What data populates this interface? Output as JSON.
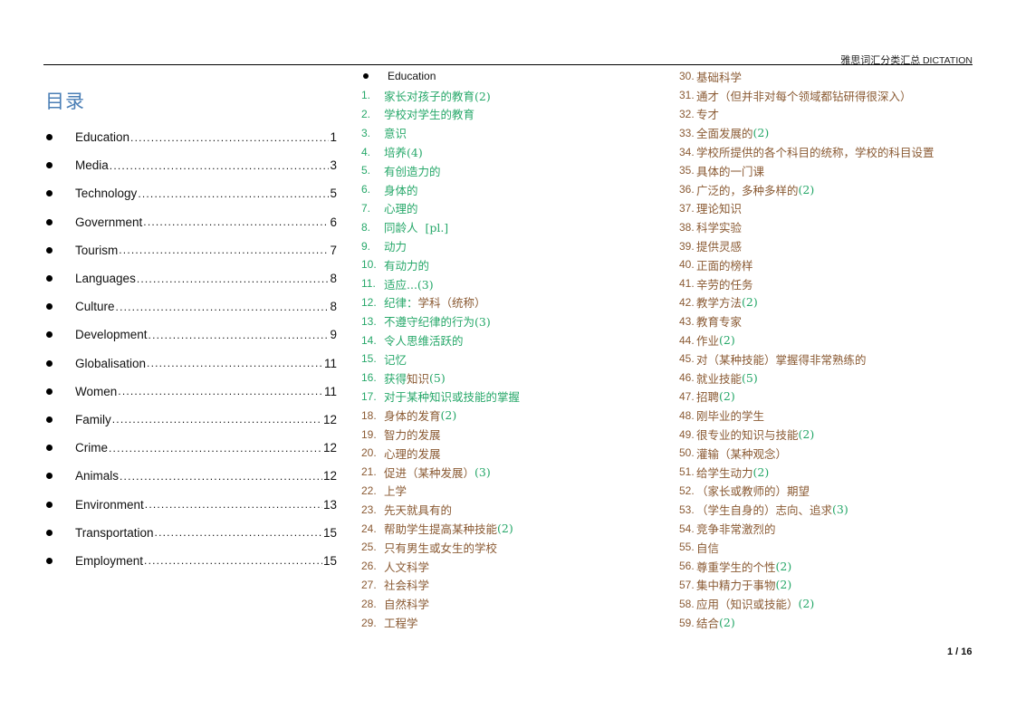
{
  "colors": {
    "green": "#27a86a",
    "brown": "#8a5a33",
    "toc_heading": "#4a7eb5"
  },
  "header": {
    "title_cn": "雅思词汇分类汇总",
    "title_en": "DICTATION"
  },
  "toc": {
    "heading": "目录",
    "items": [
      {
        "label": "Education",
        "page": "1"
      },
      {
        "label": "Media",
        "page": "3"
      },
      {
        "label": "Technology",
        "page": "5"
      },
      {
        "label": "Government",
        "page": "6"
      },
      {
        "label": "Tourism",
        "page": "7"
      },
      {
        "label": "Languages",
        "page": "8"
      },
      {
        "label": "Culture",
        "page": "8"
      },
      {
        "label": "Development",
        "page": "9"
      },
      {
        "label": "Globalisation",
        "page": "11"
      },
      {
        "label": "Women",
        "page": "11"
      },
      {
        "label": "Family",
        "page": "12"
      },
      {
        "label": "Crime",
        "page": "12"
      },
      {
        "label": "Animals",
        "page": "12"
      },
      {
        "label": "Environment",
        "page": "13"
      },
      {
        "label": "Transportation",
        "page": "15"
      },
      {
        "label": "Employment",
        "page": "15"
      }
    ]
  },
  "section": {
    "title": "Education"
  },
  "vocab": [
    {
      "num": "1.",
      "numColor": "green",
      "segs": [
        {
          "t": "家长对孩子的教育(2)",
          "c": "green"
        }
      ]
    },
    {
      "num": "2.",
      "numColor": "green",
      "segs": [
        {
          "t": "学校对学生的教育",
          "c": "green"
        }
      ]
    },
    {
      "num": "3.",
      "numColor": "green",
      "segs": [
        {
          "t": "意识",
          "c": "green"
        }
      ]
    },
    {
      "num": "4.",
      "numColor": "green",
      "segs": [
        {
          "t": "培养(4)",
          "c": "green"
        }
      ]
    },
    {
      "num": "5.",
      "numColor": "green",
      "segs": [
        {
          "t": "有创造力的",
          "c": "green"
        }
      ]
    },
    {
      "num": "6.",
      "numColor": "green",
      "segs": [
        {
          "t": "身体的",
          "c": "green"
        }
      ]
    },
    {
      "num": "7.",
      "numColor": "green",
      "segs": [
        {
          "t": "心理的",
          "c": "green"
        }
      ]
    },
    {
      "num": "8.",
      "numColor": "green",
      "segs": [
        {
          "t": "同龄人  [pl.]",
          "c": "green"
        }
      ]
    },
    {
      "num": "9.",
      "numColor": "green",
      "segs": [
        {
          "t": "动力",
          "c": "green"
        }
      ]
    },
    {
      "num": "10.",
      "numColor": "green",
      "segs": [
        {
          "t": "有动力的",
          "c": "green"
        }
      ]
    },
    {
      "num": "11.",
      "numColor": "green",
      "segs": [
        {
          "t": "适应...(3)",
          "c": "green"
        }
      ]
    },
    {
      "num": "12.",
      "numColor": "green",
      "segs": [
        {
          "t": "纪律：",
          "c": "green"
        },
        {
          "t": "学科（统称）",
          "c": "brown"
        }
      ]
    },
    {
      "num": "13.",
      "numColor": "green",
      "segs": [
        {
          "t": "不遵守纪律的行为(3)",
          "c": "green"
        }
      ]
    },
    {
      "num": "14.",
      "numColor": "green",
      "segs": [
        {
          "t": "令人思维活跃的",
          "c": "green"
        }
      ]
    },
    {
      "num": "15.",
      "numColor": "green",
      "segs": [
        {
          "t": "记忆",
          "c": "green"
        }
      ]
    },
    {
      "num": "16.",
      "numColor": "green",
      "segs": [
        {
          "t": "获得",
          "c": "green"
        },
        {
          "t": "知识",
          "c": "brown"
        },
        {
          "t": "(5)",
          "c": "green"
        }
      ]
    },
    {
      "num": "17.",
      "numColor": "green",
      "segs": [
        {
          "t": "对于某种知识或技能的掌握",
          "c": "green"
        }
      ]
    },
    {
      "num": "18.",
      "numColor": "brown",
      "segs": [
        {
          "t": "身体的发育",
          "c": "brown"
        },
        {
          "t": "(2)",
          "c": "green"
        }
      ]
    },
    {
      "num": "19.",
      "numColor": "brown",
      "segs": [
        {
          "t": "智力的发展",
          "c": "brown"
        }
      ]
    },
    {
      "num": "20.",
      "numColor": "brown",
      "segs": [
        {
          "t": "心理的发展",
          "c": "brown"
        }
      ]
    },
    {
      "num": "21.",
      "numColor": "brown",
      "segs": [
        {
          "t": "促进（某种发展）",
          "c": "brown"
        },
        {
          "t": "(3)",
          "c": "green"
        }
      ]
    },
    {
      "num": "22.",
      "numColor": "brown",
      "segs": [
        {
          "t": "上学",
          "c": "brown"
        }
      ]
    },
    {
      "num": "23.",
      "numColor": "brown",
      "segs": [
        {
          "t": "先天就具有的",
          "c": "brown"
        }
      ]
    },
    {
      "num": "24.",
      "numColor": "brown",
      "segs": [
        {
          "t": "帮助学生提高某种技能",
          "c": "brown"
        },
        {
          "t": "(2)",
          "c": "green"
        }
      ]
    },
    {
      "num": "25.",
      "numColor": "brown",
      "segs": [
        {
          "t": "只有男生或女生的学校",
          "c": "brown"
        }
      ]
    },
    {
      "num": "26.",
      "numColor": "brown",
      "segs": [
        {
          "t": "人文科学",
          "c": "brown"
        }
      ]
    },
    {
      "num": "27.",
      "numColor": "brown",
      "segs": [
        {
          "t": "社会科学",
          "c": "brown"
        }
      ]
    },
    {
      "num": "28.",
      "numColor": "brown",
      "segs": [
        {
          "t": "自然科学",
          "c": "brown"
        }
      ]
    },
    {
      "num": "29.",
      "numColor": "brown",
      "segs": [
        {
          "t": "工程学",
          "c": "brown"
        }
      ]
    },
    {
      "num": "30.",
      "numColor": "brown",
      "segs": [
        {
          "t": "基础科学",
          "c": "brown"
        }
      ]
    },
    {
      "num": "31.",
      "numColor": "brown",
      "segs": [
        {
          "t": "通才（但并非对每个领域都钻研得很深入）",
          "c": "brown"
        }
      ]
    },
    {
      "num": "32.",
      "numColor": "brown",
      "segs": [
        {
          "t": "专才",
          "c": "brown"
        }
      ]
    },
    {
      "num": "33.",
      "numColor": "brown",
      "segs": [
        {
          "t": "全面发展的",
          "c": "brown"
        },
        {
          "t": "(2)",
          "c": "green"
        }
      ]
    },
    {
      "num": "34.",
      "numColor": "brown",
      "segs": [
        {
          "t": "学校所提供的各个科目的统称，学校的科目设置",
          "c": "brown"
        }
      ]
    },
    {
      "num": "35.",
      "numColor": "brown",
      "segs": [
        {
          "t": "具体的一门课",
          "c": "brown"
        }
      ]
    },
    {
      "num": "36.",
      "numColor": "brown",
      "segs": [
        {
          "t": "广泛的，多种多样的",
          "c": "brown"
        },
        {
          "t": "(2)",
          "c": "green"
        }
      ]
    },
    {
      "num": "37.",
      "numColor": "brown",
      "segs": [
        {
          "t": "理论知识",
          "c": "brown"
        }
      ]
    },
    {
      "num": "38.",
      "numColor": "brown",
      "segs": [
        {
          "t": "科学实验",
          "c": "brown"
        }
      ]
    },
    {
      "num": "39.",
      "numColor": "brown",
      "segs": [
        {
          "t": "提供灵感",
          "c": "brown"
        }
      ]
    },
    {
      "num": "40.",
      "numColor": "brown",
      "segs": [
        {
          "t": "正面的榜样",
          "c": "brown"
        }
      ]
    },
    {
      "num": "41.",
      "numColor": "brown",
      "segs": [
        {
          "t": "辛劳的任务",
          "c": "brown"
        }
      ]
    },
    {
      "num": "42.",
      "numColor": "brown",
      "segs": [
        {
          "t": "教学方法",
          "c": "brown"
        },
        {
          "t": "(2)",
          "c": "green"
        }
      ]
    },
    {
      "num": "43.",
      "numColor": "brown",
      "segs": [
        {
          "t": "教育专家",
          "c": "brown"
        }
      ]
    },
    {
      "num": "44.",
      "numColor": "brown",
      "segs": [
        {
          "t": "作业",
          "c": "brown"
        },
        {
          "t": "(2)",
          "c": "green"
        }
      ]
    },
    {
      "num": "45.",
      "numColor": "brown",
      "segs": [
        {
          "t": "对（某种技能）掌握得非常熟练的",
          "c": "brown"
        }
      ]
    },
    {
      "num": "46.",
      "numColor": "brown",
      "segs": [
        {
          "t": "就业技能",
          "c": "brown"
        },
        {
          "t": "(5)",
          "c": "green"
        }
      ]
    },
    {
      "num": "47.",
      "numColor": "brown",
      "segs": [
        {
          "t": "招聘",
          "c": "brown"
        },
        {
          "t": "(2)",
          "c": "green"
        }
      ]
    },
    {
      "num": "48.",
      "numColor": "brown",
      "segs": [
        {
          "t": "刚毕业的学生",
          "c": "brown"
        }
      ]
    },
    {
      "num": "49.",
      "numColor": "brown",
      "segs": [
        {
          "t": "很专业的知识与技能",
          "c": "brown"
        },
        {
          "t": "(2)",
          "c": "green"
        }
      ]
    },
    {
      "num": "50.",
      "numColor": "brown",
      "segs": [
        {
          "t": "灌输（某种观念）",
          "c": "brown"
        }
      ]
    },
    {
      "num": "51.",
      "numColor": "brown",
      "segs": [
        {
          "t": "给学生动力",
          "c": "brown"
        },
        {
          "t": "(2)",
          "c": "green"
        }
      ]
    },
    {
      "num": "52.",
      "numColor": "brown",
      "segs": [
        {
          "t": "（家长或教师的）期望",
          "c": "brown"
        }
      ]
    },
    {
      "num": "53.",
      "numColor": "brown",
      "segs": [
        {
          "t": "（学生自身的）志向、追求",
          "c": "brown"
        },
        {
          "t": "(3)",
          "c": "green"
        }
      ]
    },
    {
      "num": "54.",
      "numColor": "brown",
      "segs": [
        {
          "t": "竞争非常激烈的",
          "c": "brown"
        }
      ]
    },
    {
      "num": "55.",
      "numColor": "brown",
      "segs": [
        {
          "t": "自信",
          "c": "brown"
        }
      ]
    },
    {
      "num": "56.",
      "numColor": "brown",
      "segs": [
        {
          "t": "尊重学生的个性",
          "c": "brown"
        },
        {
          "t": "(2)",
          "c": "green"
        }
      ]
    },
    {
      "num": "57.",
      "numColor": "brown",
      "segs": [
        {
          "t": "集中精力于事物",
          "c": "brown"
        },
        {
          "t": "(2)",
          "c": "green"
        }
      ]
    },
    {
      "num": "58.",
      "numColor": "brown",
      "segs": [
        {
          "t": "应用（知识或技能）",
          "c": "brown"
        },
        {
          "t": "(2)",
          "c": "green"
        }
      ]
    },
    {
      "num": "59.",
      "numColor": "brown",
      "segs": [
        {
          "t": "结合",
          "c": "brown"
        },
        {
          "t": "(2)",
          "c": "green"
        }
      ]
    }
  ],
  "footer": {
    "page_indicator": "1 / 16"
  }
}
